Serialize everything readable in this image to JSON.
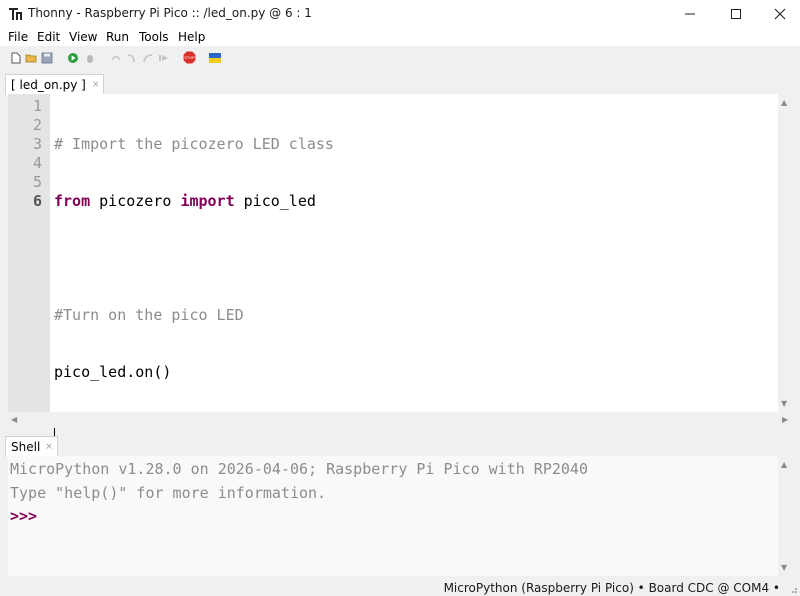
{
  "window": {
    "title": "Thonny  -  Raspberry Pi Pico :: /led_on.py  @  6 : 1",
    "controls": [
      "minimize-icon",
      "maximize-icon",
      "close-icon"
    ]
  },
  "menu": {
    "items": [
      "File",
      "Edit",
      "View",
      "Run",
      "Tools",
      "Help"
    ]
  },
  "toolbar": {
    "icons": [
      "new-file-icon",
      "open-file-icon",
      "save-icon",
      "run-icon",
      "debug-icon",
      "step-over-icon",
      "step-into-icon",
      "step-out-icon",
      "resume-icon",
      "stop-icon",
      "ukraine-flag-icon"
    ],
    "stop_label": "STOP"
  },
  "editor": {
    "tab_label": "[ led_on.py ]",
    "tab_close": "×",
    "line_numbers": [
      "1",
      "2",
      "3",
      "4",
      "5",
      "6"
    ],
    "current_line": "6",
    "lines": [
      {
        "text": "# Import the picozero LED class"
      },
      {
        "kw1": "from",
        "mid": " picozero ",
        "kw2": "import",
        "rest": " pico_led"
      },
      {
        "text": ""
      },
      {
        "text": "#Turn on the pico LED"
      },
      {
        "text": "pico_led.on()"
      },
      {
        "text": ""
      }
    ]
  },
  "shell": {
    "tab_label": "Shell",
    "tab_close": "×",
    "lines": [
      "MicroPython v1.28.0 on 2026-04-06; Raspberry Pi Pico with RP2040",
      "Type \"help()\" for more information."
    ],
    "prompt": ">>>"
  },
  "status": {
    "text": "MicroPython (Raspberry Pi Pico)  •  Board CDC @ COM4  •"
  },
  "colors": {
    "keyword": "#7f0055",
    "comment": "#8c8c8c",
    "gutter": "#e4e4e4",
    "run_green": "#2e9e3e",
    "stop_red": "#d9302c"
  }
}
